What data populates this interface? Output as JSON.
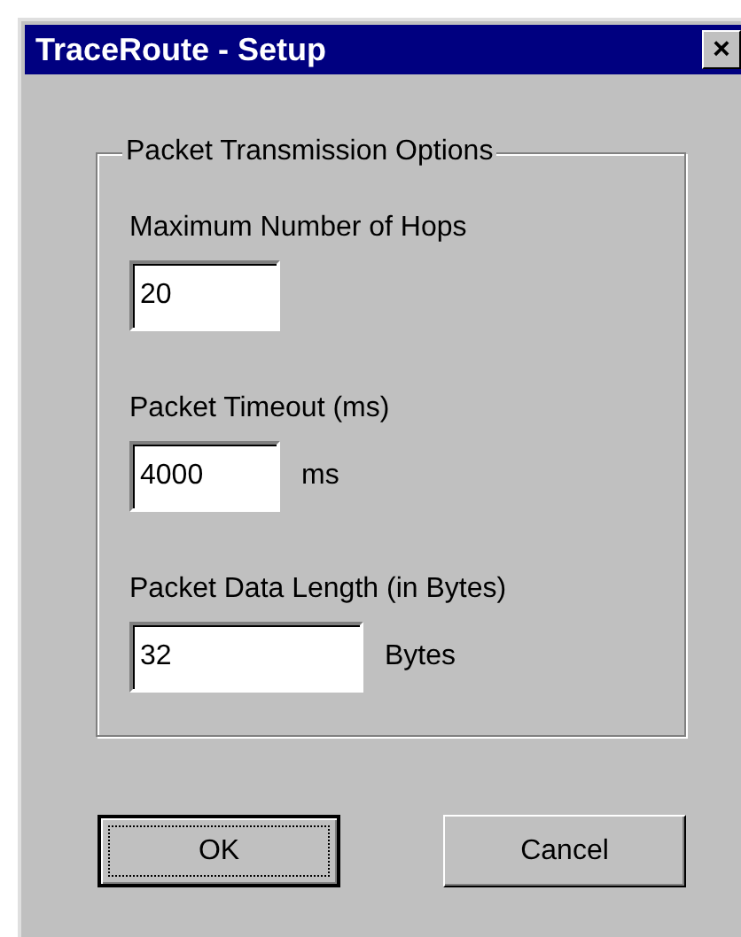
{
  "window": {
    "title": "TraceRoute - Setup",
    "close": "×"
  },
  "group": {
    "title": "Packet Transmission Options",
    "fields": [
      {
        "label": "Maximum Number of Hops",
        "value": "20",
        "kind": "narrow"
      },
      {
        "label": "Packet Timeout (ms)",
        "value": "4000",
        "unit": "ms",
        "kind": "narrow"
      },
      {
        "label": "Packet Data Length (in Bytes)",
        "value": "32",
        "unit": "Bytes",
        "kind": "wide"
      }
    ]
  },
  "buttons": [
    {
      "label": "OK",
      "default": true
    },
    {
      "label": "Cancel",
      "default": false
    }
  ]
}
